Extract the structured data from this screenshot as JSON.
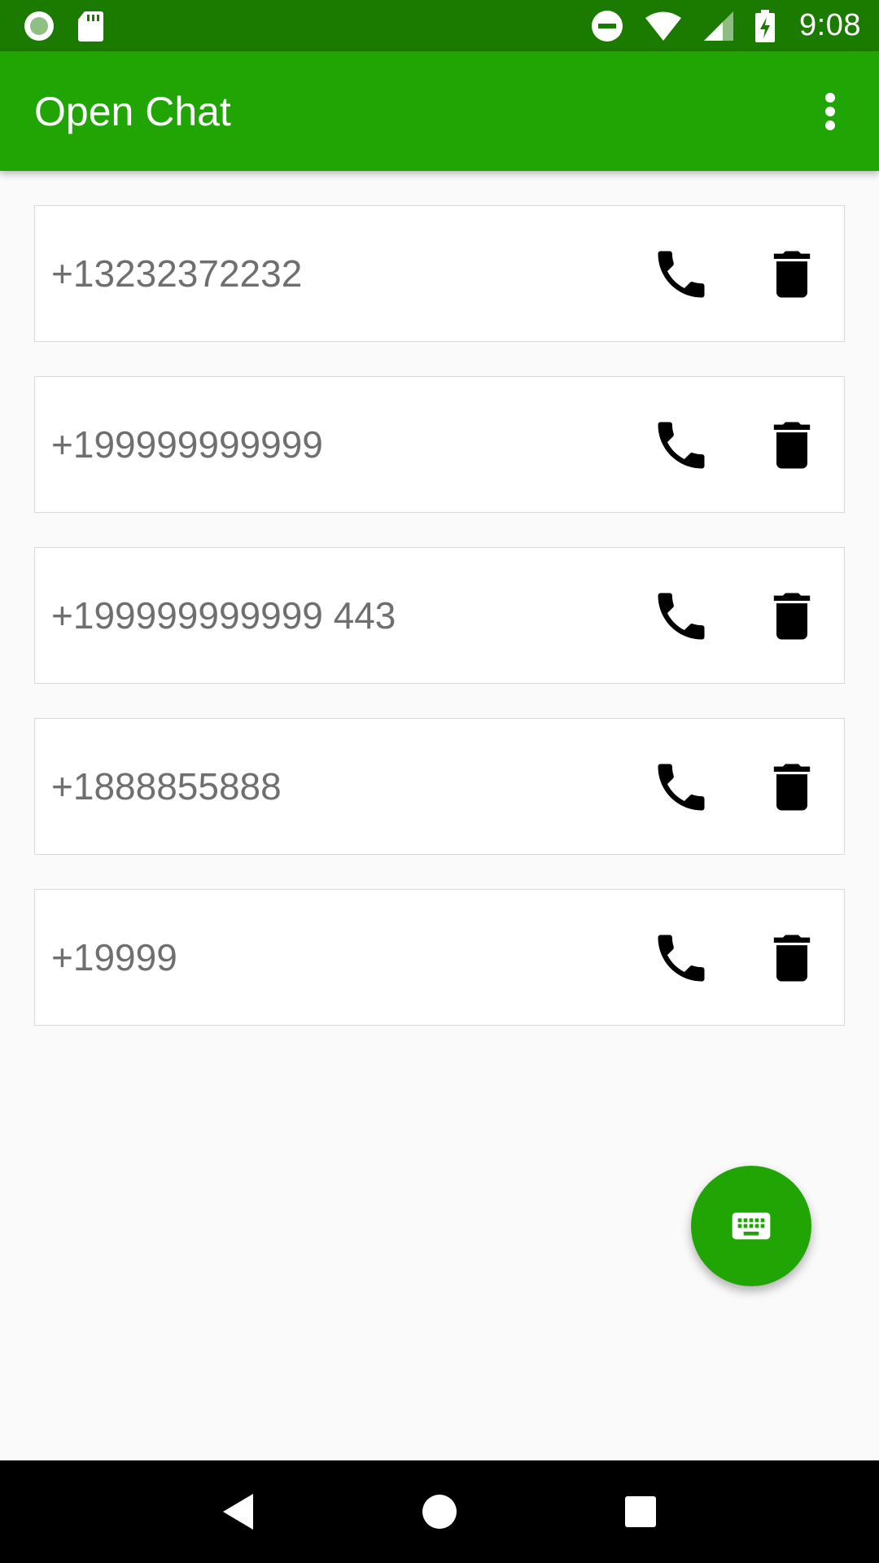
{
  "status_bar": {
    "time": "9:08",
    "left_icons": [
      "record-icon",
      "sd-card-icon"
    ],
    "right_icons": [
      "do-not-disturb-icon",
      "wifi-icon",
      "signal-icon",
      "battery-charging-icon"
    ]
  },
  "app_bar": {
    "title": "Open Chat",
    "menu_icon": "more-vert-icon"
  },
  "chats": [
    {
      "number": "+13232372232"
    },
    {
      "number": "+199999999999"
    },
    {
      "number": "+199999999999 443"
    },
    {
      "number": "+1888855888"
    },
    {
      "number": "+19999"
    }
  ],
  "row_icons": {
    "call": "phone-icon",
    "delete": "trash-icon"
  },
  "fab": {
    "icon": "keyboard-icon"
  },
  "nav_bar": {
    "icons": [
      "back-icon",
      "home-icon",
      "recents-icon"
    ]
  },
  "colors": {
    "status_bar": "#1b7a00",
    "app_bar": "#21a505",
    "accent": "#21a505",
    "background": "#fafafa",
    "number_text": "#6f6f6f"
  }
}
